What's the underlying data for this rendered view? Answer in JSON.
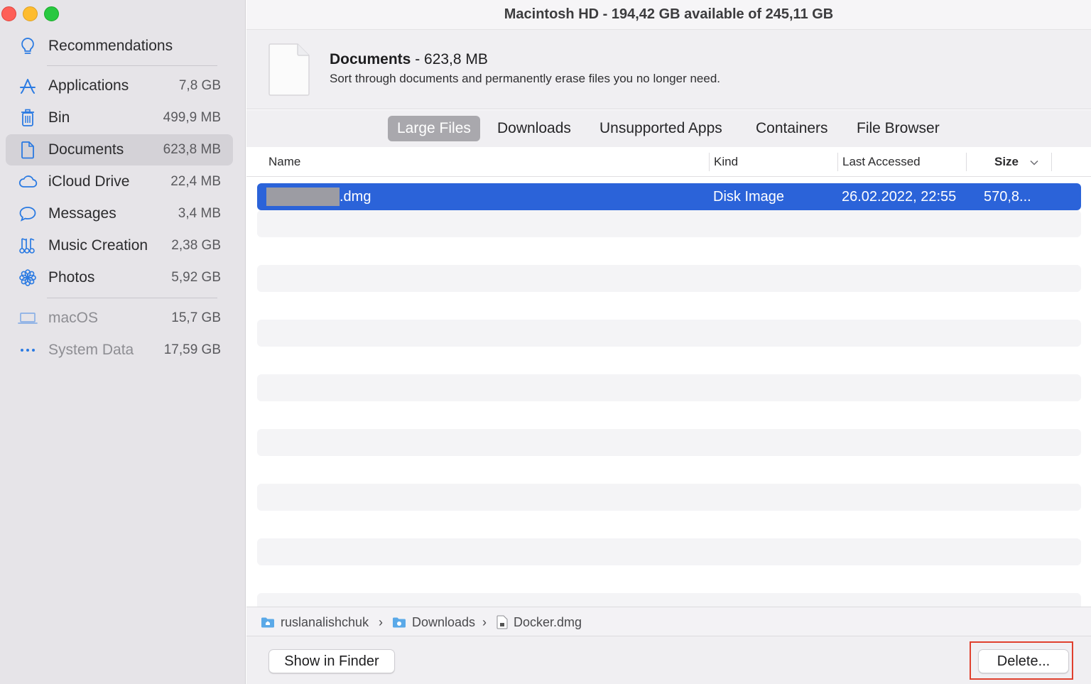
{
  "window": {
    "title": "Macintosh HD - 194,42 GB available of 245,11 GB"
  },
  "sidebar": {
    "recommendations": "Recommendations",
    "items": [
      {
        "label": "Applications",
        "size": "7,8 GB",
        "icon": "app-store-icon"
      },
      {
        "label": "Bin",
        "size": "499,9 MB",
        "icon": "trash-icon"
      },
      {
        "label": "Documents",
        "size": "623,8 MB",
        "icon": "document-icon",
        "selected": true
      },
      {
        "label": "iCloud Drive",
        "size": "22,4 MB",
        "icon": "cloud-icon"
      },
      {
        "label": "Messages",
        "size": "3,4 MB",
        "icon": "speech-bubble-icon"
      },
      {
        "label": "Music Creation",
        "size": "2,38 GB",
        "icon": "guitar-icon"
      },
      {
        "label": "Photos",
        "size": "5,92 GB",
        "icon": "photos-flower-icon"
      }
    ],
    "system_items": [
      {
        "label": "macOS",
        "size": "15,7 GB",
        "icon": "laptop-icon"
      },
      {
        "label": "System Data",
        "size": "17,59 GB",
        "icon": "ellipsis-icon"
      }
    ]
  },
  "header": {
    "title": "Documents",
    "size": " - 623,8 MB",
    "subtitle": "Sort through documents and permanently erase files you no longer need."
  },
  "tabs": [
    "Large Files",
    "Downloads",
    "Unsupported Apps",
    "Containers",
    "File Browser"
  ],
  "active_tab": "Large Files",
  "table": {
    "columns": [
      "Name",
      "Kind",
      "Last Accessed",
      "Size"
    ],
    "rows": [
      {
        "name": ".dmg",
        "kind": "Disk Image",
        "last_accessed": "26.02.2022, 22:55",
        "size": "570,8..."
      }
    ]
  },
  "path": {
    "user": "ruslanalishchuk",
    "folder": "Downloads",
    "file": "Docker.dmg"
  },
  "buttons": {
    "show_in_finder": "Show in Finder",
    "delete": "Delete..."
  },
  "colors": {
    "selection_blue": "#2b63d9",
    "highlight_red": "#e0402e",
    "sidebar_bg": "#e6e4e8",
    "accent_icon": "#2a7ae2"
  }
}
